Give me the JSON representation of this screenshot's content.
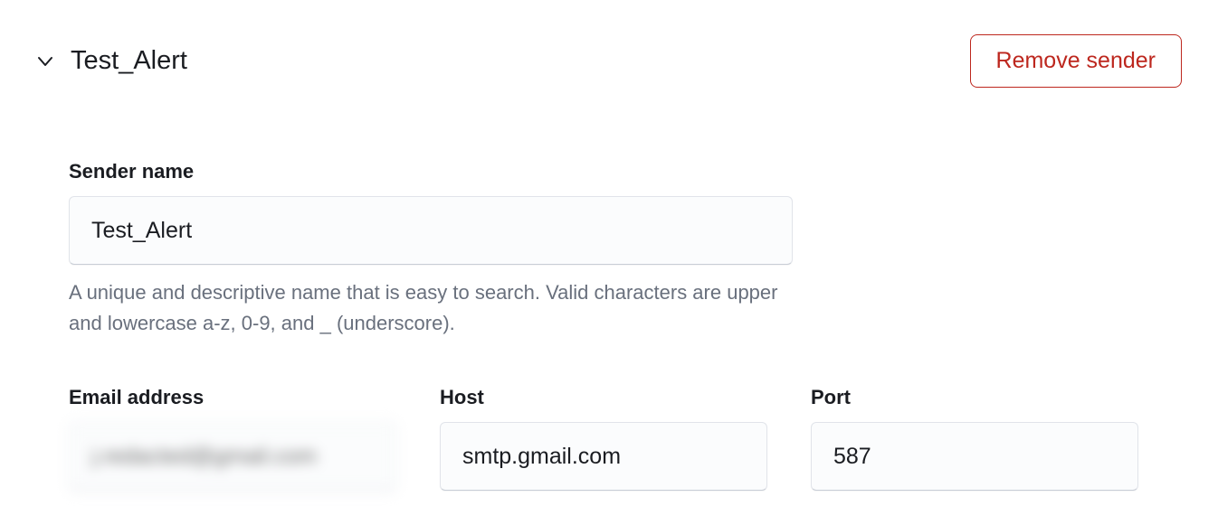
{
  "header": {
    "title": "Test_Alert",
    "remove_label": "Remove sender"
  },
  "form": {
    "sender_name": {
      "label": "Sender name",
      "value": "Test_Alert",
      "help": "A unique and descriptive name that is easy to search. Valid characters are upper and lowercase a-z, 0-9, and _ (underscore)."
    },
    "email": {
      "label": "Email address",
      "value": "j.redacted@gmail.com"
    },
    "host": {
      "label": "Host",
      "value": "smtp.gmail.com"
    },
    "port": {
      "label": "Port",
      "value": "587"
    }
  }
}
